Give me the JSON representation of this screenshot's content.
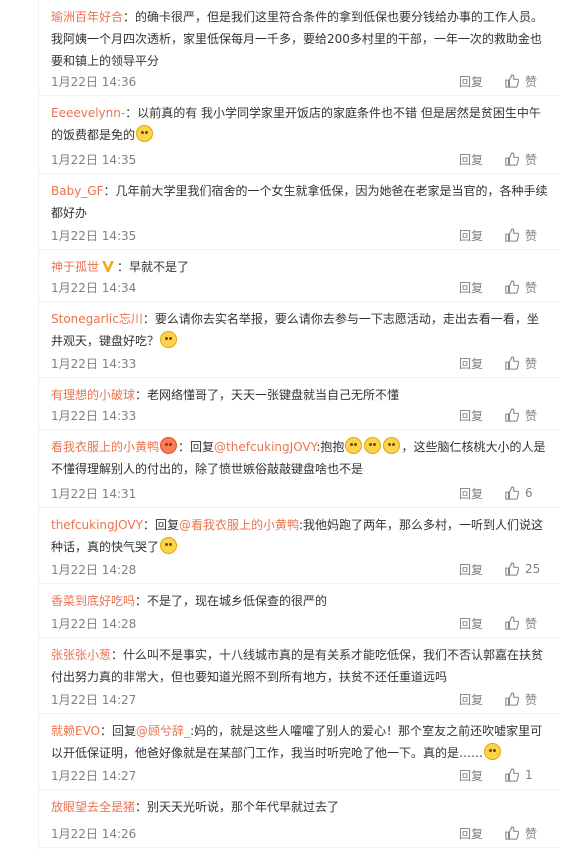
{
  "actions": {
    "reply": "回复",
    "like": "赞"
  },
  "comments": [
    {
      "user": "瑜洲百年好合",
      "text": "：的确卡很严，但是我们这里符合条件的拿到低保也要分钱给办事的工作人员。我阿姨一个月四次透析，家里低保每月一千多，要给200多村里的干部，一年一次的救助金也要和镇上的领导平分",
      "time": "1月22日 14:36",
      "likes": ""
    },
    {
      "user": "Eeeevelynn-",
      "text": "：以前真的有 我小学同学家里开饭店的家庭条件也不错 但是居然是贫困生中午的饭费都是免的",
      "time": "1月22日 14:35",
      "likes": ""
    },
    {
      "user": "Baby_GF",
      "text": "：几年前大学里我们宿舍的一个女生就拿低保，因为她爸在老家是当官的，各种手续都好办",
      "time": "1月22日 14:35",
      "likes": ""
    },
    {
      "user": "神于孤世",
      "text": "：早就不是了",
      "time": "1月22日 14:34",
      "likes": ""
    },
    {
      "user": "Stonegarlic忘川",
      "text": "：要么请你去实名举报，要么请你去参与一下志愿活动，走出去看一看，坐井观天，键盘好吃？",
      "time": "1月22日 14:33",
      "likes": ""
    },
    {
      "user": "有理想的小破球",
      "text": "：老网络懂哥了，天天一张键盘就当自己无所不懂",
      "time": "1月22日 14:33",
      "likes": ""
    },
    {
      "user": "看我衣服上的小黄鸭",
      "prefix": "：回复",
      "mention": "@thefcukingJOVY",
      "text": ":抱抱",
      "text2": "，这些脑仁核桃大小的人是不懂得理解别人的付出的，除了愤世嫉俗敲敲键盘啥也不是",
      "time": "1月22日 14:31",
      "likes": "6"
    },
    {
      "user": "thefcukingJOVY",
      "prefix": "：回复",
      "mention": "@看我衣服上的小黄鸭",
      "text": ":我他妈跑了两年，那么多村，一听到人们说这种话，真的快气哭了",
      "time": "1月22日 14:28",
      "likes": "25"
    },
    {
      "user": "香菜到底好吃吗",
      "text": "：不是了，现在城乡低保查的很严的",
      "time": "1月22日 14:28",
      "likes": ""
    },
    {
      "user": "张张张小葱",
      "text": "：什么叫不是事实，十八线城市真的是有关系才能吃低保，我们不否认郭嘉在扶贫付出努力真的非常大，但也要知道光照不到所有地方，扶贫不还任重道远吗",
      "time": "1月22日 14:27",
      "likes": ""
    },
    {
      "user": "就赖EVO",
      "prefix": "：回复",
      "mention": "@顾兮辞_",
      "text": ":妈的，就是这些人嚯嚯了别人的爱心！那个室友之前还吹嘘家里可以开低保证明，他爸好像就是在某部门工作，我当时听完呛了他一下。真的是……",
      "time": "1月22日 14:27",
      "likes": "1"
    },
    {
      "user": "放眼望去全是猪",
      "text": "：别天天光听说，那个年代早就过去了",
      "time": "1月22日 14:26",
      "likes": ""
    }
  ]
}
